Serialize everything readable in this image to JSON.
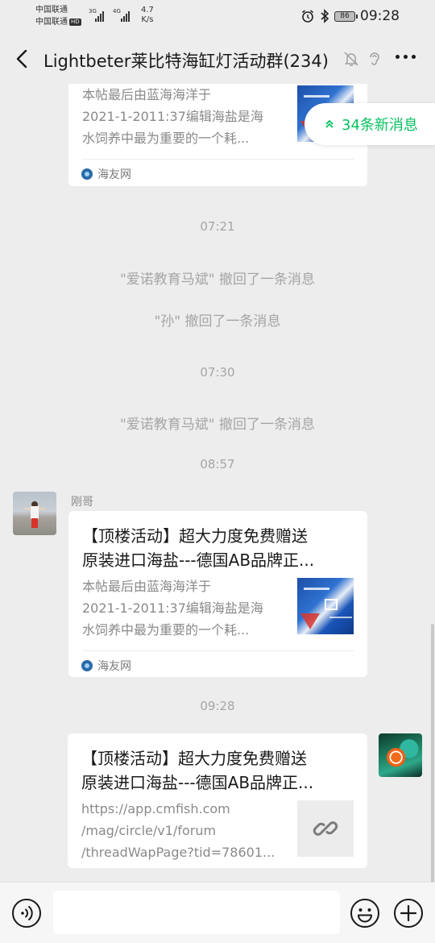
{
  "status_bar": {
    "carrier1": "中国联通",
    "carrier2": "中国联通",
    "hd": "HD",
    "net1": "3G",
    "net2": "4G",
    "speed_value": "4.7",
    "speed_unit": "K/s",
    "battery": "86",
    "time": "09:28"
  },
  "nav": {
    "title": "Lightbeter莱比特海缸灯活动群(234)"
  },
  "new_messages": {
    "label": "34条新消息"
  },
  "messages": {
    "card_top": {
      "desc_line1": "本帖最后由蓝海海洋于",
      "desc_line2": "2021-1-2011:37编辑海盐是海",
      "desc_line3": "水饲养中最为重要的一个耗...",
      "source": "海友网"
    },
    "ts1": "07:21",
    "sys1": "\"爱诺教育马斌\" 撤回了一条消息",
    "sys2": "\"孙\" 撤回了一条消息",
    "ts2": "07:30",
    "sys3": "\"爱诺教育马斌\" 撤回了一条消息",
    "ts3": "08:57",
    "card_gg": {
      "sender": "刚哥",
      "title_line1": "【顶楼活动】超大力度免费赠送",
      "title_line2": "原装进口海盐---德国AB品牌正...",
      "desc_line1": "本帖最后由蓝海海洋于",
      "desc_line2": "2021-1-2011:37编辑海盐是海",
      "desc_line3": "水饲养中最为重要的一个耗...",
      "source": "海友网"
    },
    "ts4": "09:28",
    "card_me": {
      "title_line1": "【顶楼活动】超大力度免费赠送",
      "title_line2": "原装进口海盐---德国AB品牌正...",
      "url_line1": "https://app.cmfish.com",
      "url_line2": "/mag/circle/v1/forum",
      "url_line3": "/threadWapPage?tid=78601..."
    }
  },
  "icons": {
    "back": "chevron-left-icon",
    "mute": "bell-off-icon",
    "earpiece": "ear-icon",
    "more": "more-icon",
    "voice": "voice-icon",
    "emoji": "emoji-icon",
    "plus": "plus-icon",
    "link": "link-icon"
  },
  "colors": {
    "accent": "#07c160",
    "background": "#ededed",
    "bubble": "#ffffff"
  }
}
